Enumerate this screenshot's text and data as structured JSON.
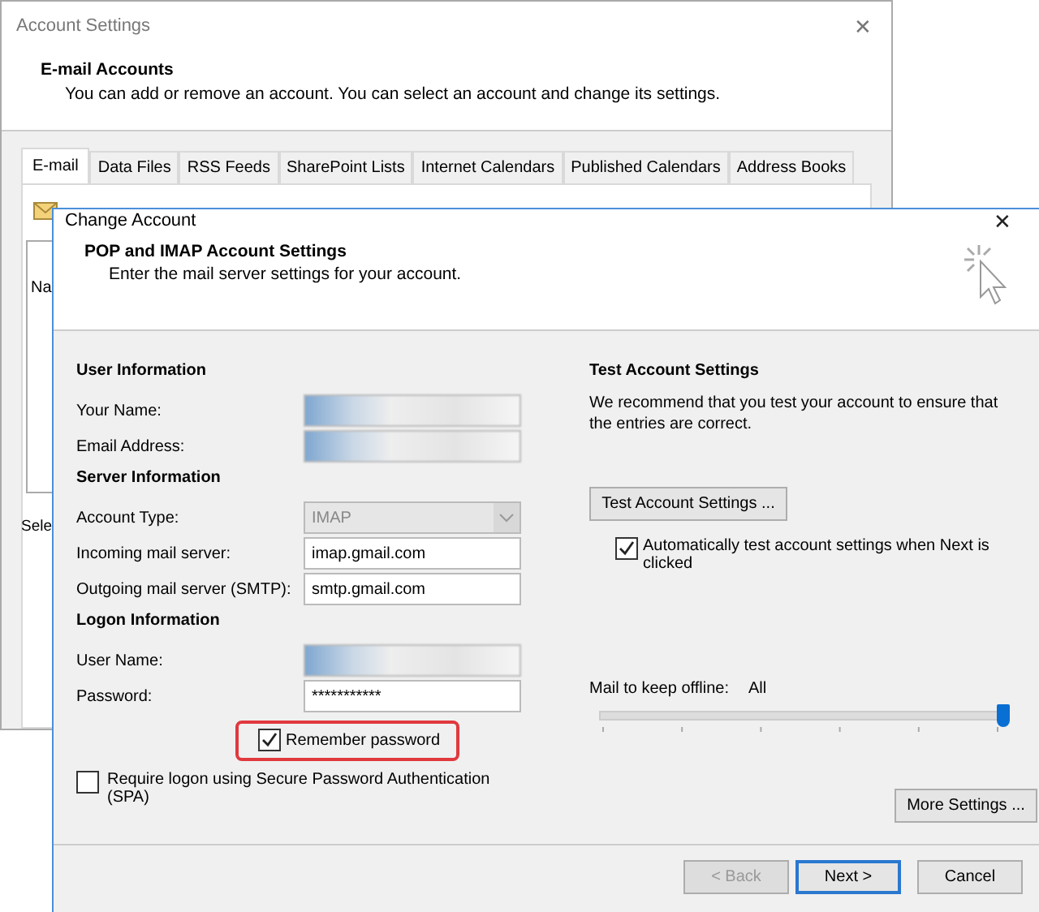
{
  "background_window": {
    "title": "Account Settings",
    "close": "✕",
    "header": {
      "title": "E-mail Accounts",
      "subtitle": "You can add or remove an account. You can select an account and change its settings."
    },
    "tabs": [
      {
        "label": "E-mail",
        "selected": true
      },
      {
        "label": "Data Files",
        "selected": false
      },
      {
        "label": "RSS Feeds",
        "selected": false
      },
      {
        "label": "SharePoint Lists",
        "selected": false
      },
      {
        "label": "Internet Calendars",
        "selected": false
      },
      {
        "label": "Published Calendars",
        "selected": false
      },
      {
        "label": "Address Books",
        "selected": false
      }
    ],
    "list_header": "Na",
    "select_text": "Sele"
  },
  "dialog": {
    "title": "Change Account",
    "close": "✕",
    "header": {
      "title": "POP and IMAP Account Settings",
      "subtitle": "Enter the mail server settings for your account."
    },
    "sections": [
      {
        "heading": "User Information",
        "fields": [
          {
            "label": "Your Name:",
            "kind": "blurred"
          },
          {
            "label": "Email Address:",
            "kind": "blurred"
          }
        ]
      },
      {
        "heading": "Server Information",
        "fields": [
          {
            "label": "Account Type:",
            "kind": "dropdown",
            "value": "IMAP",
            "disabled": true
          },
          {
            "label": "Incoming mail server:",
            "kind": "text",
            "value": "imap.gmail.com"
          },
          {
            "label": "Outgoing mail server (SMTP):",
            "kind": "text",
            "value": "smtp.gmail.com"
          }
        ]
      },
      {
        "heading": "Logon Information",
        "fields": [
          {
            "label": "User Name:",
            "kind": "blurred"
          },
          {
            "label": "Password:",
            "kind": "text",
            "value": "***********"
          }
        ]
      }
    ],
    "remember_password": {
      "label": "Remember password",
      "checked": true,
      "highlighted": true
    },
    "require_spa": {
      "label": "Require logon using Secure Password Authentication (SPA)",
      "checked": false
    },
    "test": {
      "heading": "Test Account Settings",
      "description": "We recommend that you test your account to ensure that the entries are correct.",
      "button": "Test Account Settings ...",
      "auto_test": {
        "label": "Automatically test account settings when Next is clicked",
        "checked": true
      }
    },
    "offline": {
      "label": "Mail to keep offline:",
      "value": "All",
      "level": 1
    },
    "more_settings": "More Settings ...",
    "buttons": [
      {
        "label": "< Back",
        "disabled": true,
        "default": false
      },
      {
        "label": "Next >",
        "disabled": false,
        "default": true
      },
      {
        "label": "Cancel",
        "disabled": false,
        "default": false
      }
    ]
  }
}
